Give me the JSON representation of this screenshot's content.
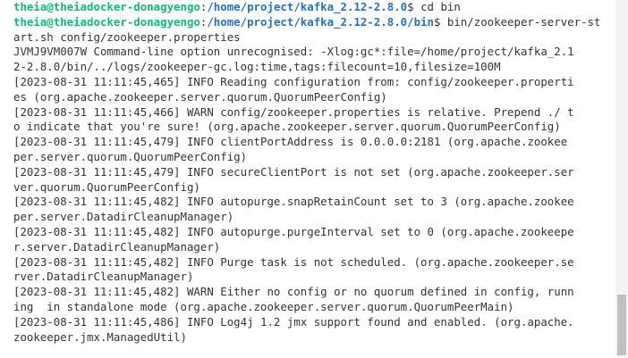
{
  "terminal": {
    "prompts": [
      {
        "user": "theia@theiadocker-donagyengo",
        "sep": ":",
        "path": "/home/project/kafka_2.12-2.8.0",
        "symbol": "$ ",
        "command": "cd bin"
      },
      {
        "user": "theia@theiadocker-donagyengo",
        "sep": ":",
        "path": "/home/project/kafka_2.12-2.8.0/bin",
        "symbol": "$ ",
        "command": "bin/zookeeper-server-st"
      }
    ],
    "output_lines": [
      "art.sh config/zookeeper.properties",
      "JVMJ9VM007W Command-line option unrecognised: -Xlog:gc*:file=/home/project/kafka_2.1",
      "2-2.8.0/bin/../logs/zookeeper-gc.log:time,tags:filecount=10,filesize=100M",
      "[2023-08-31 11:11:45,465] INFO Reading configuration from: config/zookeeper.properti",
      "es (org.apache.zookeeper.server.quorum.QuorumPeerConfig)",
      "[2023-08-31 11:11:45,466] WARN config/zookeeper.properties is relative. Prepend ./ t",
      "o indicate that you're sure! (org.apache.zookeeper.server.quorum.QuorumPeerConfig)",
      "[2023-08-31 11:11:45,479] INFO clientPortAddress is 0.0.0.0:2181 (org.apache.zookee",
      "per.server.quorum.QuorumPeerConfig)",
      "[2023-08-31 11:11:45,479] INFO secureClientPort is not set (org.apache.zookeeper.ser",
      "ver.quorum.QuorumPeerConfig)",
      "[2023-08-31 11:11:45,482] INFO autopurge.snapRetainCount set to 3 (org.apache.zookee",
      "per.server.DatadirCleanupManager)",
      "[2023-08-31 11:11:45,482] INFO autopurge.purgeInterval set to 0 (org.apache.zookeepe",
      "r.server.DatadirCleanupManager)",
      "[2023-08-31 11:11:45,482] INFO Purge task is not scheduled. (org.apache.zookeeper.se",
      "rver.DatadirCleanupManager)",
      "[2023-08-31 11:11:45,482] WARN Either no config or no quorum defined in config, runn",
      "ing  in standalone mode (org.apache.zookeeper.server.quorum.QuorumPeerMain)",
      "[2023-08-31 11:11:45,486] INFO Log4j 1.2 jmx support found and enabled. (org.apache.",
      "zookeeper.jmx.ManagedUtil)"
    ]
  }
}
